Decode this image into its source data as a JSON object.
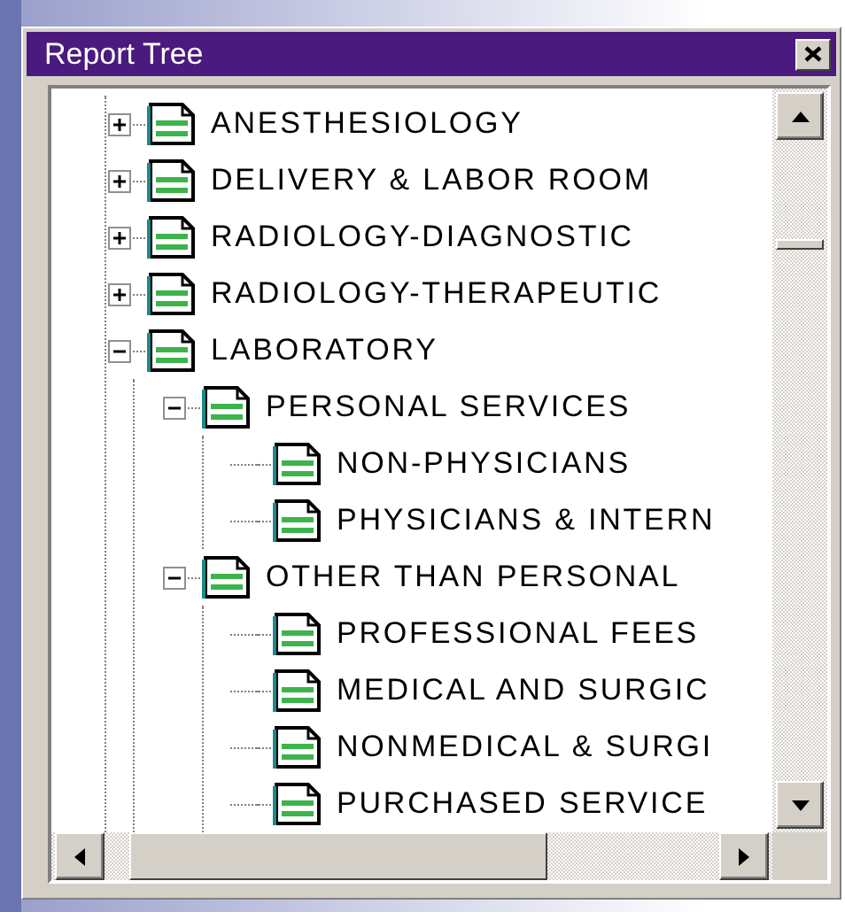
{
  "window": {
    "title": "Report Tree"
  },
  "tree": [
    {
      "label": "ANESTHESIOLOGY",
      "expanded": false
    },
    {
      "label": "DELIVERY & LABOR ROOM",
      "expanded": false
    },
    {
      "label": "RADIOLOGY-DIAGNOSTIC",
      "expanded": false
    },
    {
      "label": "RADIOLOGY-THERAPEUTIC",
      "expanded": false
    },
    {
      "label": "LABORATORY",
      "expanded": true,
      "children": [
        {
          "label": "PERSONAL SERVICES",
          "expanded": true,
          "children": [
            {
              "label": "NON-PHYSICIANS"
            },
            {
              "label": "PHYSICIANS & INTERN"
            }
          ]
        },
        {
          "label": "OTHER THAN PERSONAL",
          "expanded": true,
          "children": [
            {
              "label": "PROFESSIONAL FEES"
            },
            {
              "label": "MEDICAL AND SURGIC"
            },
            {
              "label": "NONMEDICAL & SURGI"
            },
            {
              "label": "PURCHASED SERVICE"
            }
          ]
        }
      ]
    }
  ]
}
